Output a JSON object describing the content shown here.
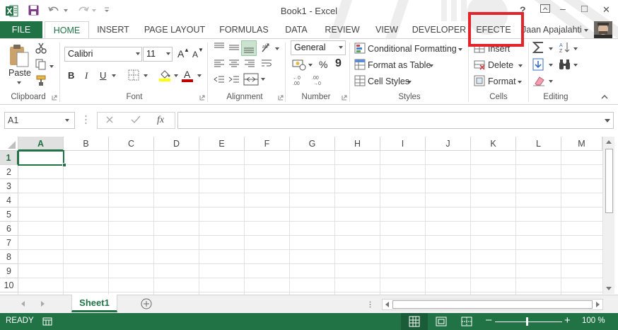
{
  "window": {
    "title": "Book1 - Excel",
    "help": "?",
    "minimize": "–",
    "maximize": "□",
    "close": "✕"
  },
  "tabs": {
    "file": "FILE",
    "home": "HOME",
    "insert": "INSERT",
    "page_layout": "PAGE LAYOUT",
    "formulas": "FORMULAS",
    "data": "DATA",
    "review": "REVIEW",
    "view": "VIEW",
    "developer": "DEVELOPER",
    "efecte": "EFECTE"
  },
  "user": {
    "name": "Jaan Apajalahti"
  },
  "ribbon": {
    "clipboard": {
      "label": "Clipboard",
      "paste": "Paste"
    },
    "font": {
      "label": "Font",
      "name": "Calibri",
      "size": "11",
      "bold": "B",
      "italic": "I",
      "underline": "U",
      "grow": "A",
      "shrink": "A",
      "font_color": "A"
    },
    "alignment": {
      "label": "Alignment"
    },
    "number": {
      "label": "Number",
      "format": "General",
      "percent": "%",
      "comma": "9"
    },
    "styles": {
      "label": "Styles",
      "conditional": "Conditional Formatting",
      "format_table": "Format as Table",
      "cell_styles": "Cell Styles"
    },
    "cells": {
      "label": "Cells",
      "insert": "Insert",
      "delete": "Delete",
      "format": "Format"
    },
    "editing": {
      "label": "Editing"
    }
  },
  "formula_bar": {
    "name_box": "A1",
    "fx": "fx",
    "value": ""
  },
  "grid": {
    "columns": [
      "A",
      "B",
      "C",
      "D",
      "E",
      "F",
      "G",
      "H",
      "I",
      "J",
      "K",
      "L",
      "M"
    ],
    "rows": [
      "1",
      "2",
      "3",
      "4",
      "5",
      "6",
      "7",
      "8",
      "9",
      "10"
    ],
    "active_cell": "A1"
  },
  "sheets": {
    "active": "Sheet1"
  },
  "status": {
    "ready": "READY",
    "zoom": "100 %",
    "zoom_minus": "–",
    "zoom_plus": "+"
  },
  "colors": {
    "accent": "#217346",
    "highlight_box": "#e3242b"
  }
}
